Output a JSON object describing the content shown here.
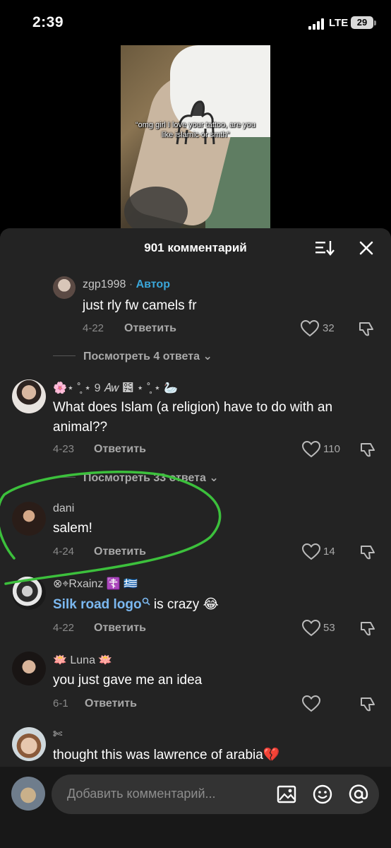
{
  "status_bar": {
    "time": "2:39",
    "network": "LTE",
    "battery": "29"
  },
  "video": {
    "caption": "“omg girl I love your tattoo, are you like islamic or smth”"
  },
  "sheet": {
    "title": "901 комментарий"
  },
  "comments": [
    {
      "username": "zgp1998",
      "author_label": "Автор",
      "text": "just rly fw camels fr",
      "date": "4-22",
      "reply": "Ответить",
      "likes": "32",
      "view_replies": "Посмотреть 4 ответа"
    },
    {
      "username": "🌸⋆ ˚̥ ⋆ 9 𝐴𝑤 ౴ ⋆ ˚̥ ⋆ 🦢",
      "text": "What does Islam (a religion) have to do with an animal??",
      "date": "4-23",
      "reply": "Ответить",
      "likes": "110",
      "view_replies": "Посмотреть 33 ответа"
    },
    {
      "username": "dani",
      "text": "salem!",
      "date": "4-24",
      "reply": "Ответить",
      "likes": "14"
    },
    {
      "username": "⊗⌖Rxainz ☦️ 🇬🇷",
      "link_text": "Silk road logo",
      "text_suffix": " is crazy 😂",
      "date": "4-22",
      "reply": "Ответить",
      "likes": "53"
    },
    {
      "username": "🪷 Luna 🪷",
      "text": "you just gave me an idea",
      "date": "6-1",
      "reply": "Ответить",
      "likes": ""
    },
    {
      "username": "✄",
      "text": "thought this was lawrence of arabia💔"
    }
  ],
  "input": {
    "placeholder": "Добавить комментарий..."
  },
  "colors": {
    "sheet_bg": "#232323",
    "author": "#3aa6d9",
    "link": "#7bb8f0",
    "annotation": "#3cc03c"
  },
  "icons": [
    "signal-icon",
    "sort-icon",
    "close-icon",
    "heart-icon",
    "dislike-icon",
    "search-icon",
    "image-icon",
    "emoji-icon",
    "mention-icon"
  ]
}
